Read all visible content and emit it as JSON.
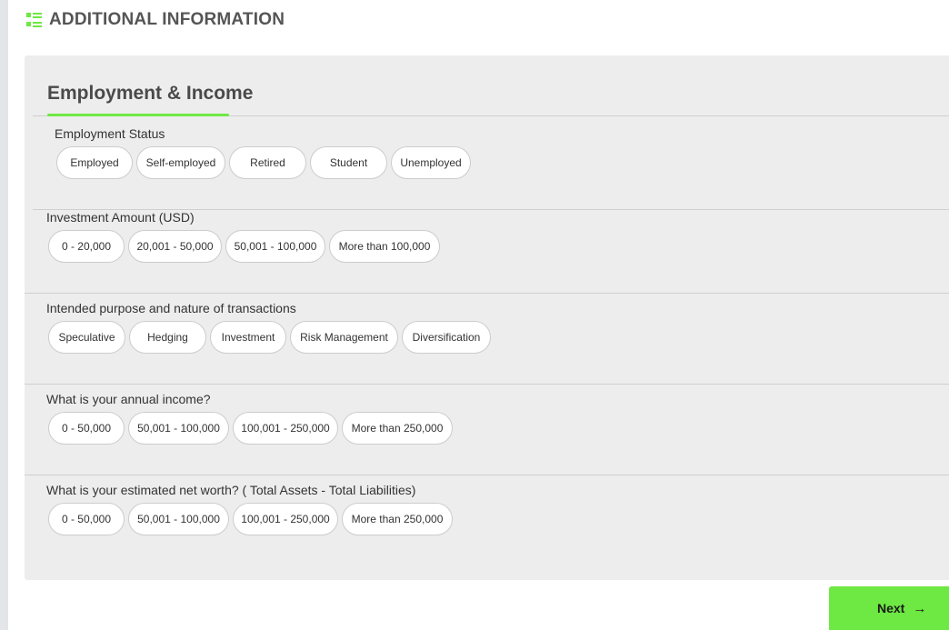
{
  "header": {
    "icon": "list-icon",
    "title": "ADDITIONAL INFORMATION"
  },
  "panel": {
    "title": "Employment & Income",
    "accent_color": "#6ee843"
  },
  "sections": [
    {
      "label": "Employment Status",
      "options": [
        "Employed",
        "Self-employed",
        "Retired",
        "Student",
        "Unemployed"
      ]
    },
    {
      "label": "Investment Amount (USD)",
      "options": [
        "0 - 20,000",
        "20,001 - 50,000",
        "50,001 - 100,000",
        "More than 100,000"
      ]
    },
    {
      "label": "Intended purpose and nature of transactions",
      "options": [
        "Speculative",
        "Hedging",
        "Investment",
        "Risk Management",
        "Diversification"
      ]
    },
    {
      "label": "What is your annual income?",
      "options": [
        "0 - 50,000",
        "50,001 - 100,000",
        "100,001 - 250,000",
        "More than 250,000"
      ]
    },
    {
      "label": "What is your estimated net worth? ( Total Assets - Total Liabilities)",
      "options": [
        "0 - 50,000",
        "50,001 - 100,000",
        "100,001 - 250,000",
        "More than 250,000"
      ]
    }
  ],
  "footer": {
    "next_label": "Next",
    "next_icon": "arrow-right-icon",
    "next_arrow_glyph": "→"
  }
}
